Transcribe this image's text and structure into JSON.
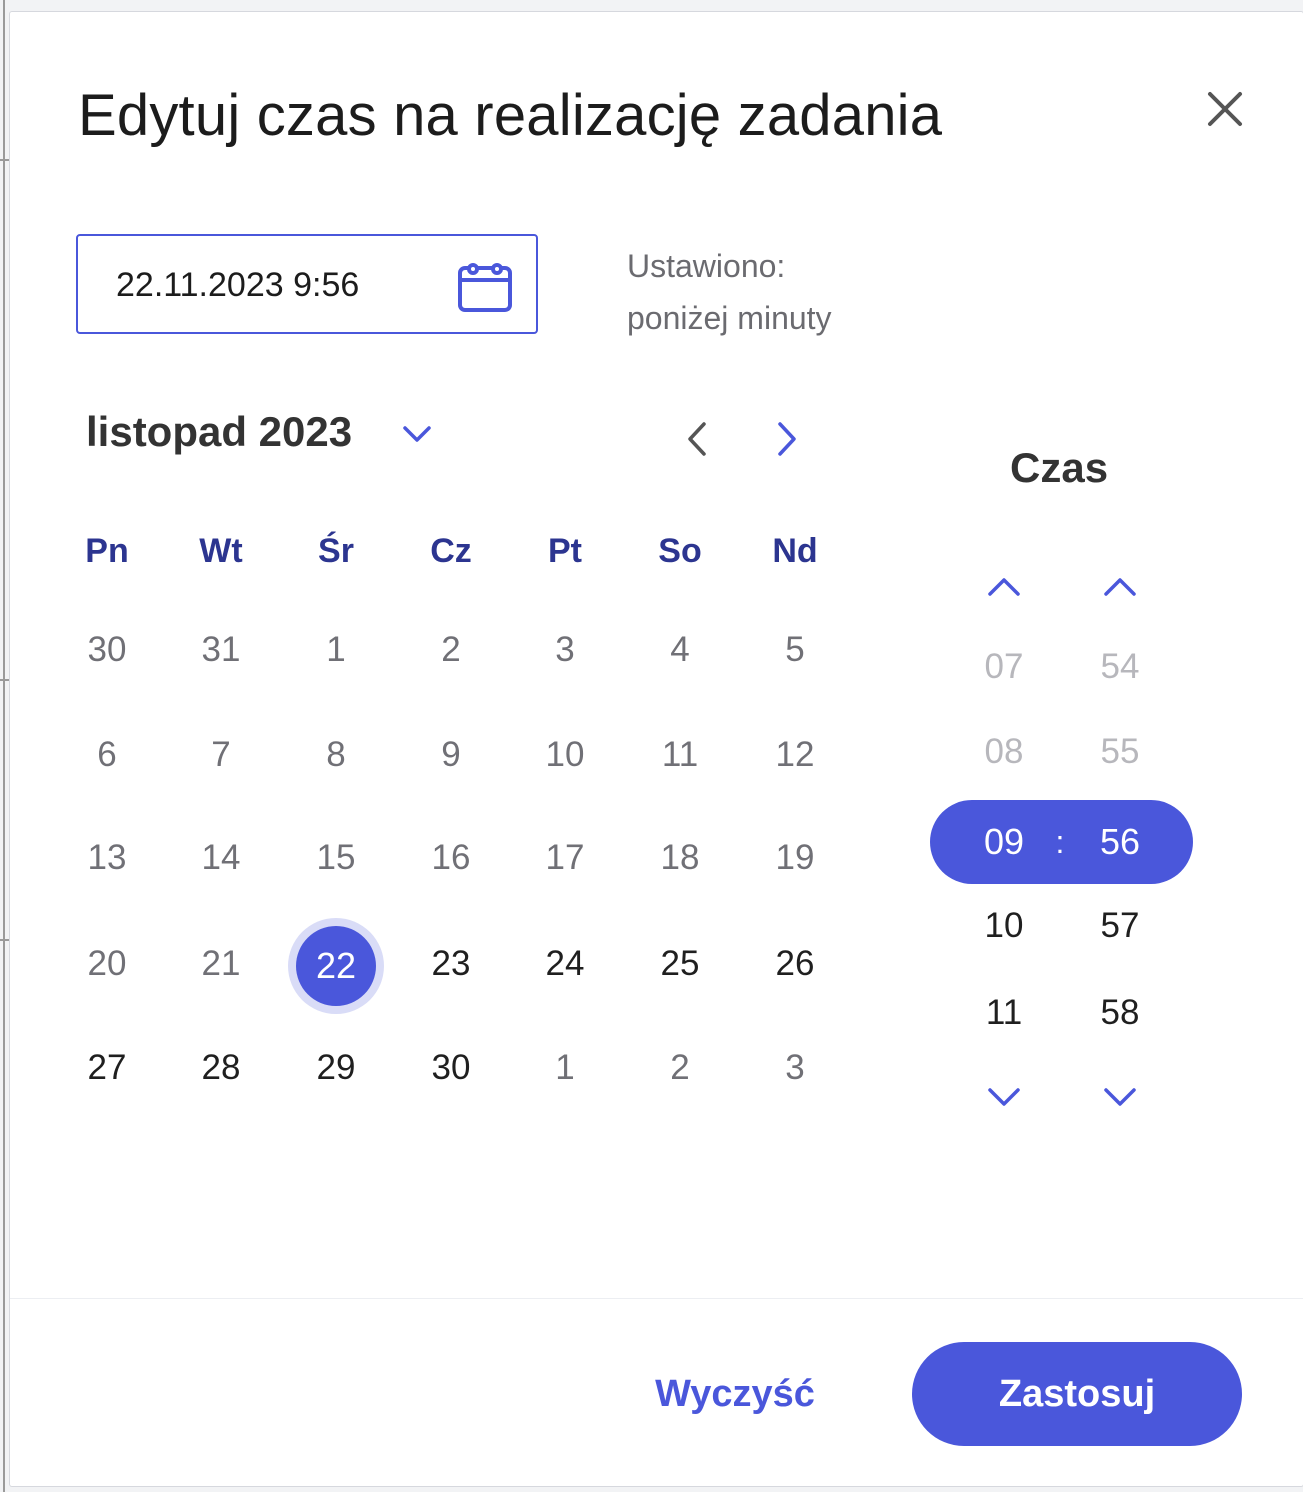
{
  "dialog": {
    "title": "Edytuj czas na realizację zadania",
    "close_icon": "close-icon"
  },
  "datetime_input": {
    "value": "22.11.2023 9:56",
    "icon": "calendar-icon"
  },
  "status": {
    "label": "Ustawiono:",
    "value": "poniżej minuty"
  },
  "calendar": {
    "month_label": "listopad 2023",
    "weekdays": [
      "Pn",
      "Wt",
      "Śr",
      "Cz",
      "Pt",
      "So",
      "Nd"
    ],
    "weeks": [
      [
        "30",
        "31",
        "1",
        "2",
        "3",
        "4",
        "5"
      ],
      [
        "6",
        "7",
        "8",
        "9",
        "10",
        "11",
        "12"
      ],
      [
        "13",
        "14",
        "15",
        "16",
        "17",
        "18",
        "19"
      ],
      [
        "20",
        "21",
        "22",
        "23",
        "24",
        "25",
        "26"
      ],
      [
        "27",
        "28",
        "29",
        "30",
        "1",
        "2",
        "3"
      ]
    ],
    "selected_day": "22"
  },
  "time": {
    "heading": "Czas",
    "hours": [
      "07",
      "08",
      "09",
      "10",
      "11"
    ],
    "minutes": [
      "54",
      "55",
      "56",
      "57",
      "58"
    ],
    "selected_hour": "09",
    "selected_minute": "56",
    "separator": ":"
  },
  "footer": {
    "clear_label": "Wyczyść",
    "apply_label": "Zastosuj"
  },
  "colors": {
    "accent": "#4a57db",
    "accent_light": "#d9dcf7",
    "weekday_text": "#2c3590"
  }
}
